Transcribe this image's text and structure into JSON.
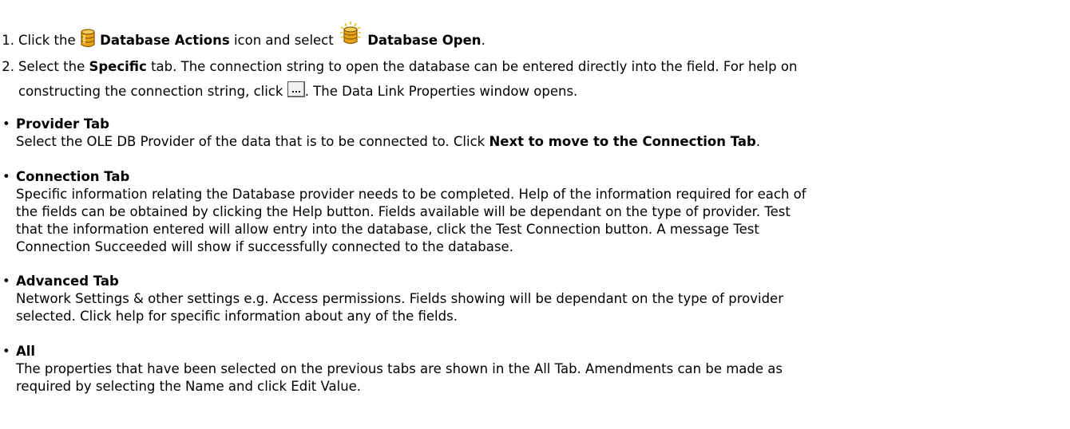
{
  "step1": {
    "number": "1.",
    "pre": "Click the",
    "actions_bold": "Database Actions",
    "mid": "icon and select",
    "open_bold": "Database Open",
    "end": "."
  },
  "step2": {
    "number": "2.",
    "pre": "Select the",
    "specific_bold": "Specific",
    "line1_rest": "tab. The connection string to open the database can be entered directly into the field. For help on",
    "line2_pre": "constructing the connection string, click",
    "line2_post": ". The Data Link Properties window opens."
  },
  "bullets": [
    {
      "title": "Provider Tab",
      "text_pre": "Select the OLE DB Provider of the data that is to be connected to. Click",
      "text_bold": "Next to move to the Connection Tab",
      "text_post": "."
    },
    {
      "title": "Connection Tab",
      "lines": [
        "Specific information relating the Database provider needs to be completed. Help of the information required for each of",
        "the fields can be obtained by clicking the Help button. Fields available will be dependant on the type of provider. Test",
        "that the information entered will allow entry into the database, click the Test Connection button. A message Test",
        "Connection Succeeded will show if successfully connected to the database."
      ]
    },
    {
      "title": "Advanced Tab",
      "lines": [
        "Network Settings & other settings e.g. Access permissions. Fields showing will be dependant on the type of provider",
        "selected. Click help for specific information about any of the fields."
      ]
    },
    {
      "title": "All",
      "lines": [
        "The properties that have been selected on the previous tabs are shown in the All Tab. Amendments can be made as",
        "required by selecting the Name and click Edit Value."
      ]
    }
  ]
}
